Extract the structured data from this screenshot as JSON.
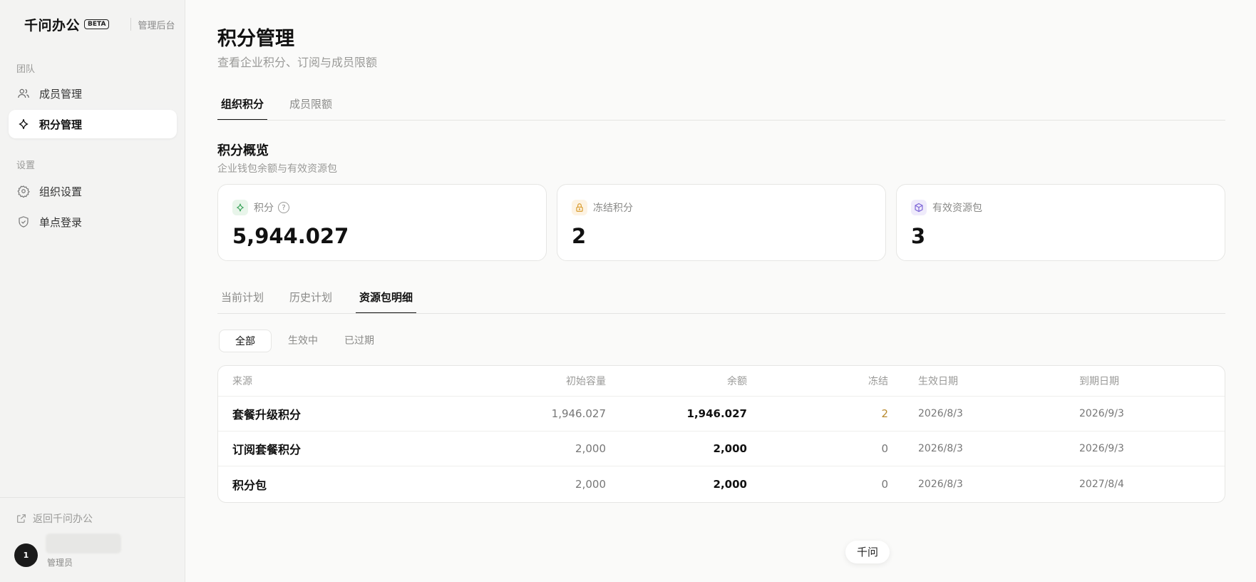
{
  "sidebar": {
    "brand": "千问办公",
    "beta": "BETA",
    "admin_label": "管理后台",
    "section_team": "团队",
    "section_settings": "设置",
    "items": [
      {
        "label": "成员管理",
        "icon": "users-icon"
      },
      {
        "label": "积分管理",
        "icon": "sparkle-icon",
        "active": true
      },
      {
        "label": "组织设置",
        "icon": "gear-icon"
      },
      {
        "label": "单点登录",
        "icon": "shield-icon"
      }
    ],
    "back_link": "返回千问办公",
    "avatar_text": "1",
    "user_role": "管理员"
  },
  "page": {
    "title": "积分管理",
    "subtitle": "查看企业积分、订阅与成员限额"
  },
  "top_tabs": [
    {
      "label": "组织积分",
      "active": true
    },
    {
      "label": "成员限额",
      "active": false
    }
  ],
  "overview": {
    "title": "积分概览",
    "subtitle": "企业钱包余额与有效资源包",
    "cards": [
      {
        "label": "积分",
        "value": "5,944.027",
        "icon": "sparkle-icon",
        "color": "#3aa35a"
      },
      {
        "label": "冻结积分",
        "value": "2",
        "icon": "lock-icon",
        "color": "#d89a2b"
      },
      {
        "label": "有效资源包",
        "value": "3",
        "icon": "package-icon",
        "color": "#7b63d6"
      }
    ]
  },
  "sub_tabs": [
    {
      "label": "当前计划",
      "active": false
    },
    {
      "label": "历史计划",
      "active": false
    },
    {
      "label": "资源包明细",
      "active": true
    }
  ],
  "filters": [
    {
      "label": "全部",
      "active": true
    },
    {
      "label": "生效中",
      "active": false
    },
    {
      "label": "已过期",
      "active": false
    }
  ],
  "table": {
    "headers": [
      "来源",
      "初始容量",
      "余额",
      "冻结",
      "生效日期",
      "到期日期"
    ],
    "rows": [
      [
        "套餐升级积分",
        "1,946.027",
        "1,946.027",
        "2",
        "2026/8/3",
        "2026/9/3"
      ],
      [
        "订阅套餐积分",
        "2,000",
        "2,000",
        "0",
        "2026/8/3",
        "2026/9/3"
      ],
      [
        "积分包",
        "2,000",
        "2,000",
        "0",
        "2026/8/3",
        "2027/8/4"
      ]
    ]
  },
  "floating_chip": "千问"
}
